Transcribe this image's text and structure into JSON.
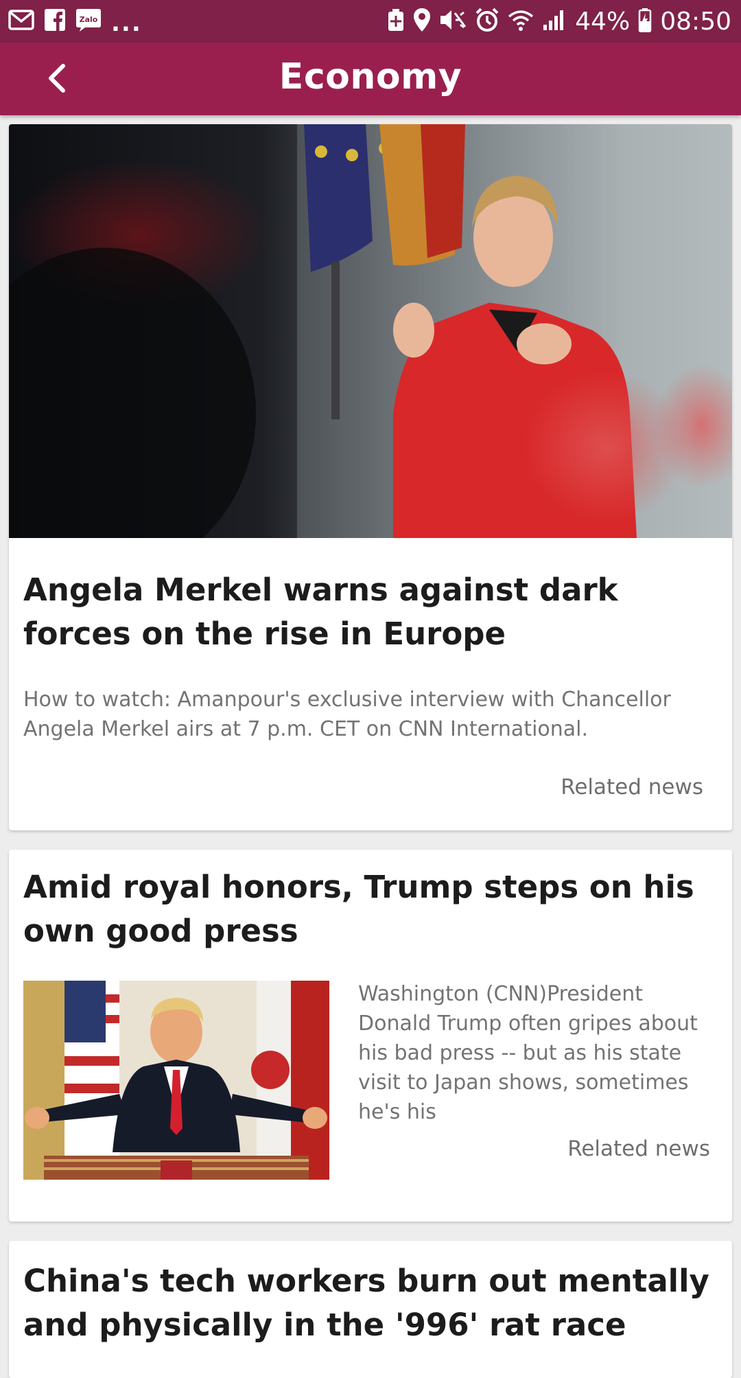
{
  "status_bar": {
    "left_icons": [
      "mail-icon",
      "facebook-icon",
      "zalo-icon"
    ],
    "zalo_label": "Zalo",
    "more": "...",
    "right_icons": [
      "battery-saver-icon",
      "location-icon",
      "mute-icon",
      "alarm-icon",
      "wifi-icon",
      "signal-icon"
    ],
    "battery": "44%",
    "time": "08:50"
  },
  "app_bar": {
    "back_icon": "chevron-left-icon",
    "title": "Economy"
  },
  "articles": [
    {
      "title": "Angela Merkel warns against dark forces on the rise in Europe",
      "summary": "How to watch: Amanpour's exclusive interview with Chancellor Angela Merkel airs at 7 p.m. CET on CNN International.",
      "related": "Related news"
    },
    {
      "title": "Amid royal honors, Trump steps on his own good press",
      "summary": "Washington (CNN)President Donald Trump often gripes about his bad press -- but as his state visit to Japan shows, sometimes he's his",
      "related": "Related news"
    },
    {
      "title": "China's tech workers burn out mentally and physically in the '996' rat race"
    }
  ],
  "colors": {
    "status_bar": "#7f2148",
    "app_bar": "#9a1f4f",
    "background": "#ededed"
  }
}
